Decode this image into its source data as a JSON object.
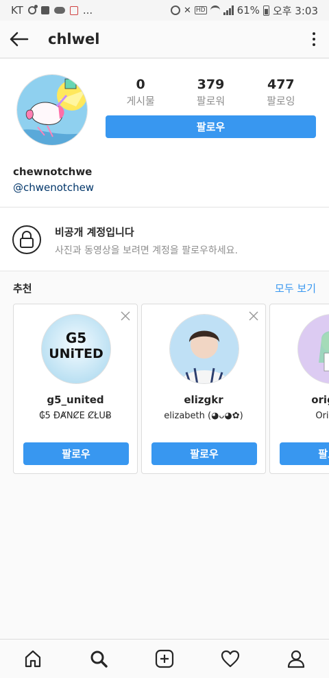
{
  "status_bar": {
    "carrier": "KT",
    "more": "...",
    "battery": "61%",
    "time": "오후 3:03"
  },
  "header": {
    "username": "chlwel"
  },
  "profile": {
    "stats": [
      {
        "value": "0",
        "label": "게시물"
      },
      {
        "value": "379",
        "label": "팔로워"
      },
      {
        "value": "477",
        "label": "팔로잉"
      }
    ],
    "follow_label": "팔로우",
    "display_name": "chewnotchwe",
    "link": "@chwenotchew"
  },
  "private": {
    "title": "비공개 계정입니다",
    "description": "사진과 동영상을 보려면 계정을 팔로우하세요."
  },
  "suggestions": {
    "title": "추천",
    "see_all": "모두 보기",
    "cards": [
      {
        "username": "g5_united",
        "full_name": "₲5 ĐȺNȻE ȻŁUɃ",
        "follow": "팔로우",
        "avatar_text": [
          "G5",
          "UNiTED"
        ]
      },
      {
        "username": "elizgkr",
        "full_name": "elizabeth  (◕ᴗ◕✿)",
        "follow": "팔로우"
      },
      {
        "username": "origina",
        "full_name": "Origina",
        "follow": "팔로우"
      }
    ]
  },
  "colors": {
    "accent": "#3897f0",
    "text": "#262626",
    "muted": "#8e8e8e"
  },
  "icons": [
    "back-arrow-icon",
    "more-vertical-icon",
    "lock-icon",
    "close-icon",
    "home-icon",
    "search-icon",
    "add-post-icon",
    "heart-icon",
    "profile-icon"
  ]
}
